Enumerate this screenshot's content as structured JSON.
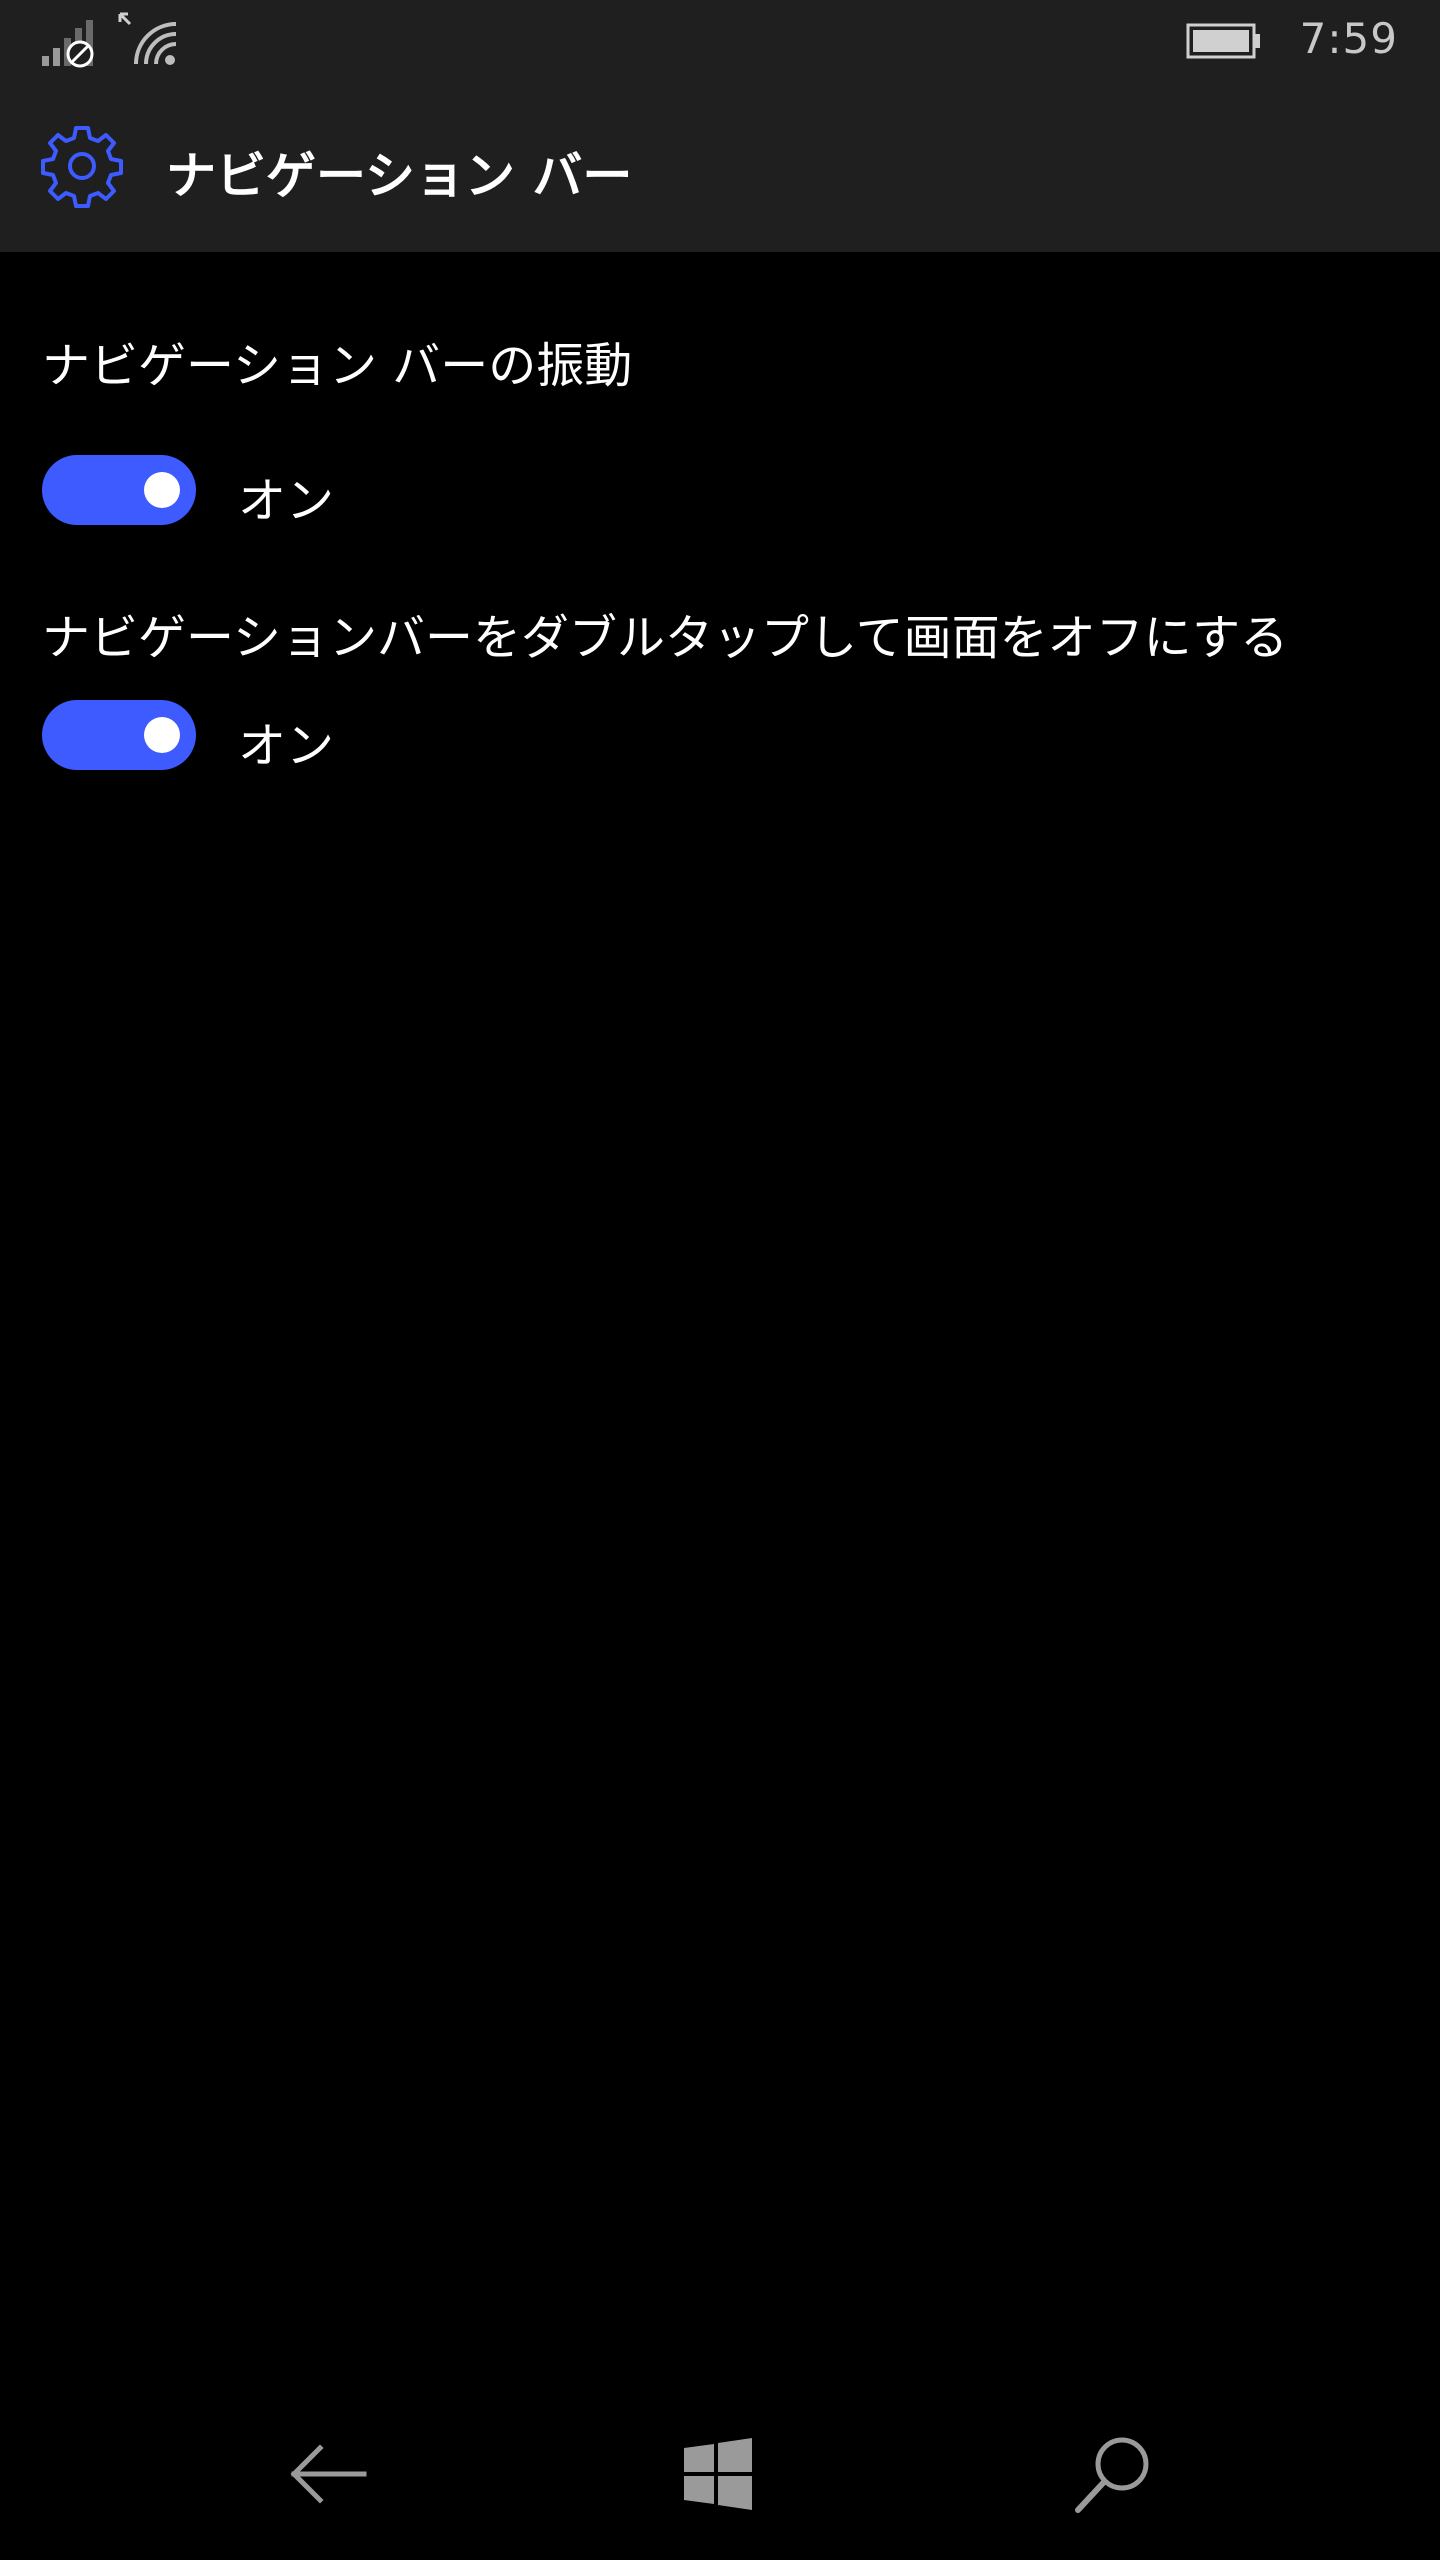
{
  "status_bar": {
    "time": "7:59",
    "icons": [
      "signal-icon",
      "wifi-icon",
      "battery-icon"
    ]
  },
  "header": {
    "title": "ナビゲーション バー",
    "icon": "gear-icon"
  },
  "settings": [
    {
      "label": "ナビゲーション バーの振動",
      "state": "オン",
      "enabled": true
    },
    {
      "label": "ナビゲーションバーをダブルタップして画面をオフにする",
      "state": "オン",
      "enabled": true
    }
  ],
  "nav_bar": {
    "icons": [
      "back-arrow-icon",
      "windows-start-icon",
      "search-icon"
    ]
  },
  "colors": {
    "accent": "#3d5bff",
    "header_bg": "#1f1f1f",
    "background": "#000000"
  }
}
